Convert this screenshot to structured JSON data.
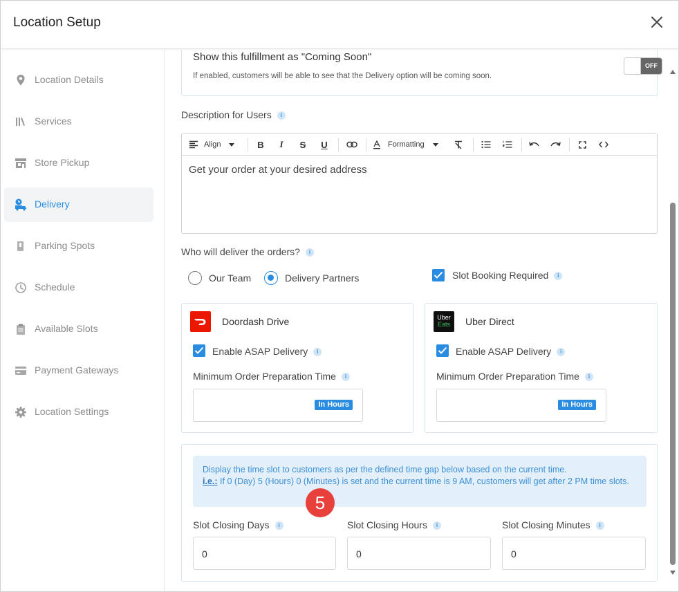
{
  "header": {
    "title": "Location Setup"
  },
  "sidebar": {
    "items": [
      {
        "label": "Location Details",
        "icon": "map-pin-icon"
      },
      {
        "label": "Services",
        "icon": "services-icon"
      },
      {
        "label": "Store Pickup",
        "icon": "store-icon"
      },
      {
        "label": "Delivery",
        "icon": "delivery-icon",
        "active": true
      },
      {
        "label": "Parking Spots",
        "icon": "parking-icon"
      },
      {
        "label": "Schedule",
        "icon": "clock-icon"
      },
      {
        "label": "Available Slots",
        "icon": "clipboard-icon"
      },
      {
        "label": "Payment Gateways",
        "icon": "card-icon"
      },
      {
        "label": "Location Settings",
        "icon": "gear-icon"
      }
    ]
  },
  "coming_soon": {
    "title": "Show this fulfillment as \"Coming Soon\"",
    "description": "If enabled, customers will be able to see that the Delivery option will be coming soon.",
    "toggle_label": "OFF"
  },
  "description": {
    "label": "Description for Users",
    "toolbar": {
      "align": "Align",
      "formatting": "Formatting"
    },
    "text": "Get your order at your desired address"
  },
  "delivery_by": {
    "label": "Who will deliver the orders?",
    "options": [
      "Our Team",
      "Delivery Partners"
    ],
    "selected": "Delivery Partners",
    "slot_booking_label": "Slot Booking Required",
    "slot_booking_checked": true
  },
  "partners": [
    {
      "name": "Doordash Drive",
      "logo_color": "#eb1700",
      "asap_label": "Enable ASAP Delivery",
      "asap_checked": true,
      "prep_label": "Minimum Order Preparation Time",
      "unit": "In Hours",
      "value": ""
    },
    {
      "name": "Uber Direct",
      "logo_color": "#0f0f0f",
      "logo_text_top": "Uber",
      "logo_text_bottom": "Eats",
      "asap_label": "Enable ASAP Delivery",
      "asap_checked": true,
      "prep_label": "Minimum Order Preparation Time",
      "unit": "In Hours",
      "value": ""
    }
  ],
  "slots": {
    "notice_line1": "Display the time slot to customers as per the defined time gap below based on the current time.",
    "notice_ie": "i.e.:",
    "notice_line2": " If 0 (Day) 5 (Hours) 0 (Minutes) is set and the current time is 9 AM, customers will get after 2 PM time slots.",
    "fields": [
      {
        "label": "Slot Closing Days",
        "value": "0"
      },
      {
        "label": "Slot Closing Hours",
        "value": "0"
      },
      {
        "label": "Slot Closing Minutes",
        "value": "0"
      }
    ]
  },
  "step_badge": "5",
  "colors": {
    "accent": "#2a8ce0",
    "step": "#e8413b"
  }
}
